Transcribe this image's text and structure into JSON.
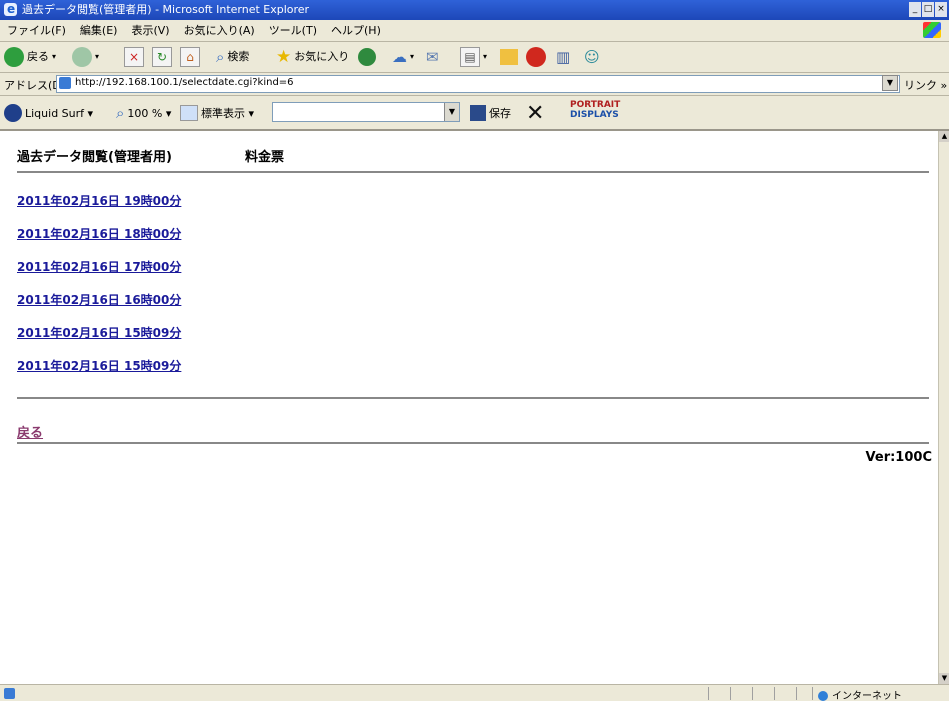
{
  "window": {
    "title": "過去データ閲覧(管理者用) - Microsoft Internet Explorer",
    "controls": [
      "_",
      "□",
      "×"
    ]
  },
  "menu": [
    "ファイル(F)",
    "編集(E)",
    "表示(V)",
    "お気に入り(A)",
    "ツール(T)",
    "ヘルプ(H)"
  ],
  "toolbar": {
    "back_label": "戻る",
    "search_label": "検索",
    "favorites_label": "お気に入り"
  },
  "address": {
    "label": "アドレス(D)",
    "url": "http://192.168.100.1/selectdate.cgi?kind=6",
    "links_label": "リンク »"
  },
  "liquid_toolbar": {
    "liquid_surf_label": "Liquid Surf ▾",
    "zoom_label": "100 % ▾",
    "view_label": "標準表示 ▾",
    "save_label": "保存",
    "logo_top": "PORTRAIT",
    "logo_bottom": "DISPLAYS"
  },
  "page": {
    "heading": "過去データ閲覧(管理者用)",
    "subheading": "料金票",
    "entries": [
      "2011年02月16日 19時00分",
      "2011年02月16日 18時00分",
      "2011年02月16日 17時00分",
      "2011年02月16日 16時00分",
      "2011年02月16日 15時09分",
      "2011年02月16日 15時09分"
    ],
    "back_link": "戻る",
    "version": "Ver:100C"
  },
  "status": {
    "zone": "インターネット"
  }
}
